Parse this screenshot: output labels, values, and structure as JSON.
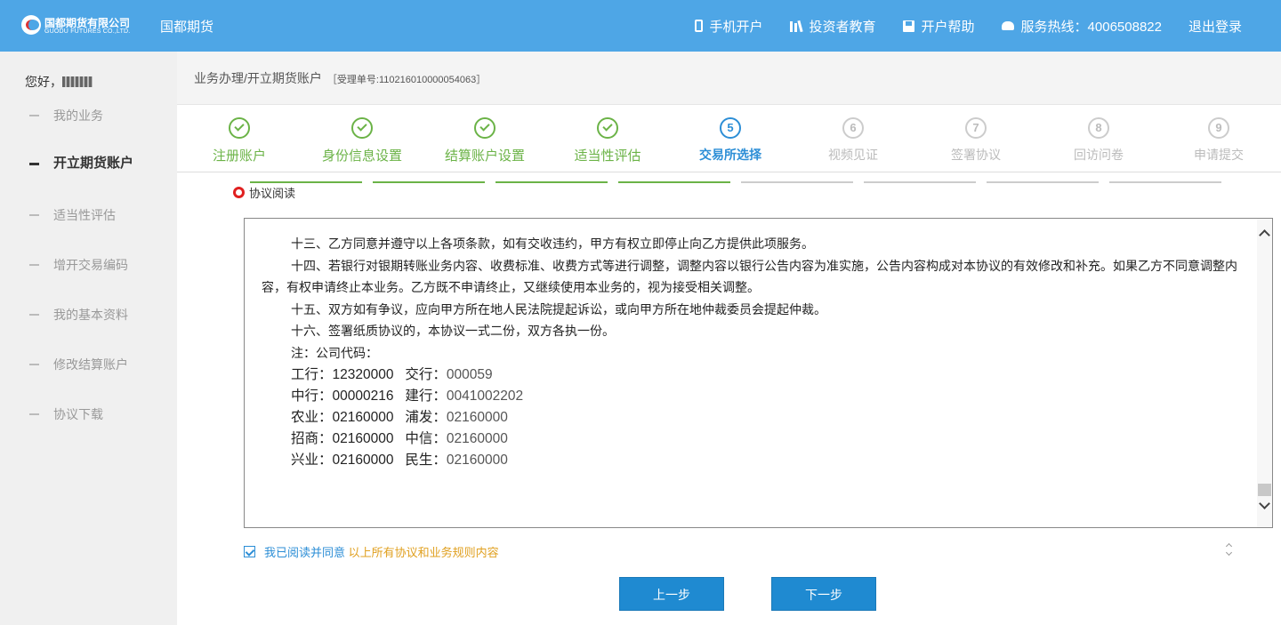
{
  "header": {
    "logo_cn": "国都期货有限公司",
    "logo_en": "GUODU FUTURES CO.,LTD.",
    "brand": "国都期货",
    "nav": [
      {
        "icon": "phone-icon",
        "label": "手机开户"
      },
      {
        "icon": "books-icon",
        "label": "投资者教育"
      },
      {
        "icon": "save-icon",
        "label": "开户帮助"
      },
      {
        "icon": "telephone-icon",
        "label": "服务热线：4006508822"
      },
      {
        "icon": "",
        "label": "退出登录"
      }
    ]
  },
  "sidebar": {
    "greeting": "您好，",
    "items": [
      {
        "label": "我的业务"
      },
      {
        "label": "开立期货账户"
      },
      {
        "label": "适当性评估"
      },
      {
        "label": "增开交易编码"
      },
      {
        "label": "我的基本资料"
      },
      {
        "label": "修改结算账户"
      },
      {
        "label": "协议下载"
      }
    ]
  },
  "breadcrumb": {
    "path": "业务办理/开立期货账户",
    "ticket": "［受理单号:110216010000054063］"
  },
  "steps": [
    {
      "number": "1",
      "label": "注册账户",
      "state": "done"
    },
    {
      "number": "2",
      "label": "身份信息设置",
      "state": "done"
    },
    {
      "number": "3",
      "label": "结算账户设置",
      "state": "done"
    },
    {
      "number": "4",
      "label": "适当性评估",
      "state": "done"
    },
    {
      "number": "5",
      "label": "交易所选择",
      "state": "current"
    },
    {
      "number": "6",
      "label": "视频见证",
      "state": "todo"
    },
    {
      "number": "7",
      "label": "签署协议",
      "state": "todo"
    },
    {
      "number": "8",
      "label": "回访问卷",
      "state": "todo"
    },
    {
      "number": "9",
      "label": "申请提交",
      "state": "todo"
    }
  ],
  "section_title": "协议阅读",
  "agreement": {
    "paragraphs": [
      "十三、乙方同意并遵守以上各项条款，如有交收违约，甲方有权立即停止向乙方提供此项服务。",
      "十四、若银行对银期转账业务内容、收费标准、收费方式等进行调整，调整内容以银行公告内容为准实施，公告内容构成对本协议的有效修改和补充。如果乙方不同意调整内容，有权申请终止本业务。乙方既不申请终止，又继续使用本业务的，视为接受相关调整。",
      "十五、双方如有争议，应向甲方所在地人民法院提起诉讼，或向甲方所在地仲裁委员会提起仲裁。",
      "十六、签署纸质协议的，本协议一式二份，双方各执一份。",
      "注：公司代码："
    ],
    "codes": [
      {
        "a_label": "工行：",
        "a_value": "12320000",
        "b_label": "交行：",
        "b_value": "000059"
      },
      {
        "a_label": "中行：",
        "a_value": "00000216",
        "b_label": "建行：",
        "b_value": "0041002202"
      },
      {
        "a_label": "农业：",
        "a_value": "02160000",
        "b_label": "浦发：",
        "b_value": "02160000"
      },
      {
        "a_label": "招商：",
        "a_value": "02160000",
        "b_label": "中信：",
        "b_value": "02160000"
      },
      {
        "a_label": "兴业：",
        "a_value": "02160000",
        "b_label": "民生：",
        "b_value": "02160000"
      }
    ]
  },
  "consent": {
    "checked": true,
    "text_1": "我已阅读并同意",
    "text_2": "以上所有协议和业务规则内容"
  },
  "buttons": {
    "prev": "上一步",
    "next": "下一步"
  },
  "colors": {
    "header_bg": "#4ea6e6",
    "done_green": "#6bb347",
    "current_blue": "#2c8ed6",
    "button_blue": "#1f8ad1",
    "consent_orange": "#e0a020",
    "marker_red": "#e02020"
  }
}
